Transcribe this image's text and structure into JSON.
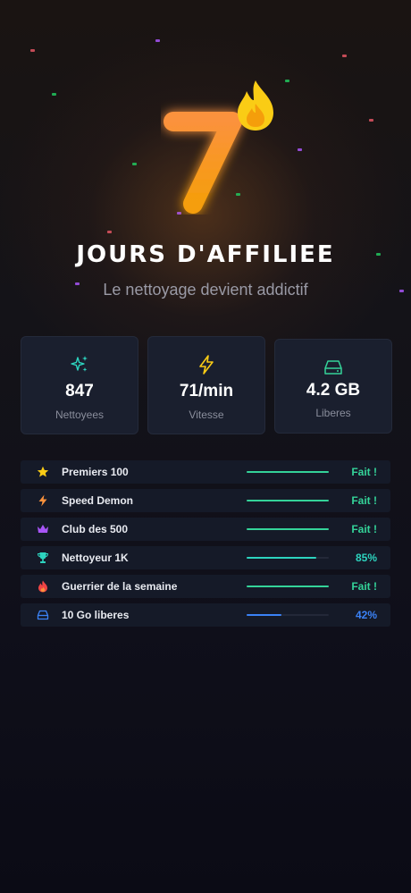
{
  "hero": {
    "number": "7",
    "icon": "flame-icon"
  },
  "title": "JOURS D'AFFILIEE",
  "subtitle": "Le nettoyage devient addictif",
  "stats": [
    {
      "icon": "sparkles-icon",
      "value": "847",
      "label": "Nettoyees",
      "color": "#2dd4bf"
    },
    {
      "icon": "lightning-icon",
      "value": "71/min",
      "label": "Vitesse",
      "color": "#facc15"
    },
    {
      "icon": "drive-icon",
      "value": "4.2 GB",
      "label": "Liberes",
      "color": "#34d399"
    }
  ],
  "achievements": [
    {
      "icon": "star-icon",
      "label": "Premiers 100",
      "progress": 1.0,
      "status": "Fait !",
      "color": "#34d399"
    },
    {
      "icon": "lightning-icon",
      "label": "Speed Demon",
      "progress": 1.0,
      "status": "Fait !",
      "color": "#34d399"
    },
    {
      "icon": "crown-icon",
      "label": "Club des 500",
      "progress": 1.0,
      "status": "Fait !",
      "color": "#34d399"
    },
    {
      "icon": "trophy-icon",
      "label": "Nettoyeur 1K",
      "progress": 0.85,
      "status": "85%",
      "color": "#2dd4bf"
    },
    {
      "icon": "flame-icon",
      "label": "Guerrier de la semaine",
      "progress": 1.0,
      "status": "Fait !",
      "color": "#34d399"
    },
    {
      "icon": "drive-icon",
      "label": "10 Go liberes",
      "progress": 0.42,
      "status": "42%",
      "color": "#3b82f6"
    }
  ],
  "colors": {
    "accent": "#f59e0b",
    "flame": "#facc15",
    "done": "#34d399",
    "partial": "#2dd4bf",
    "info": "#3b82f6"
  }
}
